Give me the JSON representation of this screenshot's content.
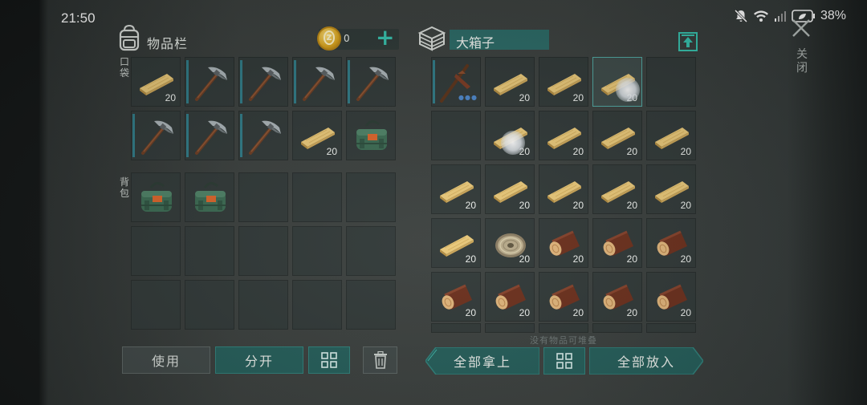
{
  "status_bar": {
    "time": "21:50",
    "battery": "38%"
  },
  "inventory": {
    "title": "物品栏",
    "coins": "0",
    "pockets_label": "口袋",
    "backpack_label": "背包",
    "pockets": [
      {
        "item": "plank",
        "qty": "20"
      },
      {
        "item": "pickaxe",
        "qty": ""
      },
      {
        "item": "pickaxe",
        "qty": ""
      },
      {
        "item": "pickaxe",
        "qty": ""
      },
      {
        "item": "pickaxe",
        "qty": ""
      },
      {
        "item": "pickaxe",
        "qty": ""
      },
      {
        "item": "pickaxe",
        "qty": ""
      },
      {
        "item": "pickaxe",
        "qty": ""
      },
      {
        "item": "plank",
        "qty": "20"
      },
      {
        "item": "bag",
        "qty": ""
      }
    ],
    "backpack": [
      {
        "item": "bag",
        "qty": ""
      },
      {
        "item": "bag",
        "qty": ""
      },
      {
        "item": "",
        "qty": ""
      },
      {
        "item": "",
        "qty": ""
      },
      {
        "item": "",
        "qty": ""
      },
      {
        "item": "",
        "qty": ""
      },
      {
        "item": "",
        "qty": ""
      },
      {
        "item": "",
        "qty": ""
      },
      {
        "item": "",
        "qty": ""
      },
      {
        "item": "",
        "qty": ""
      },
      {
        "item": "",
        "qty": ""
      },
      {
        "item": "",
        "qty": ""
      },
      {
        "item": "",
        "qty": ""
      },
      {
        "item": "",
        "qty": ""
      },
      {
        "item": "",
        "qty": ""
      }
    ],
    "buttons": {
      "use": "使用",
      "split": "分开"
    }
  },
  "container": {
    "name": "大箱子",
    "hint": "没有物品可堆叠",
    "slots": [
      {
        "item": "pickaxe-crude",
        "qty": ""
      },
      {
        "item": "plank",
        "qty": "20"
      },
      {
        "item": "plank",
        "qty": "20"
      },
      {
        "item": "plank",
        "qty": "20"
      },
      {
        "item": "",
        "qty": ""
      },
      {
        "item": "",
        "qty": ""
      },
      {
        "item": "plank",
        "qty": "20"
      },
      {
        "item": "plank",
        "qty": "20"
      },
      {
        "item": "plank",
        "qty": "20"
      },
      {
        "item": "plank",
        "qty": "20"
      },
      {
        "item": "plank",
        "qty": "20"
      },
      {
        "item": "plank",
        "qty": "20"
      },
      {
        "item": "plank",
        "qty": "20"
      },
      {
        "item": "plank",
        "qty": "20"
      },
      {
        "item": "plank",
        "qty": "20"
      },
      {
        "item": "plank",
        "qty": "20"
      },
      {
        "item": "wire",
        "qty": "20"
      },
      {
        "item": "log",
        "qty": "20"
      },
      {
        "item": "log",
        "qty": "20"
      },
      {
        "item": "log",
        "qty": "20"
      },
      {
        "item": "log",
        "qty": "20"
      },
      {
        "item": "log",
        "qty": "20"
      },
      {
        "item": "log",
        "qty": "20"
      },
      {
        "item": "log",
        "qty": "20"
      },
      {
        "item": "log",
        "qty": "20"
      }
    ],
    "buttons": {
      "take_all": "全部拿上",
      "put_all": "全部放入"
    }
  },
  "close_label": "关闭",
  "colors": {
    "accent": "#36c1ad",
    "button_teal": "#245d59",
    "slot_bg": "#303837"
  }
}
